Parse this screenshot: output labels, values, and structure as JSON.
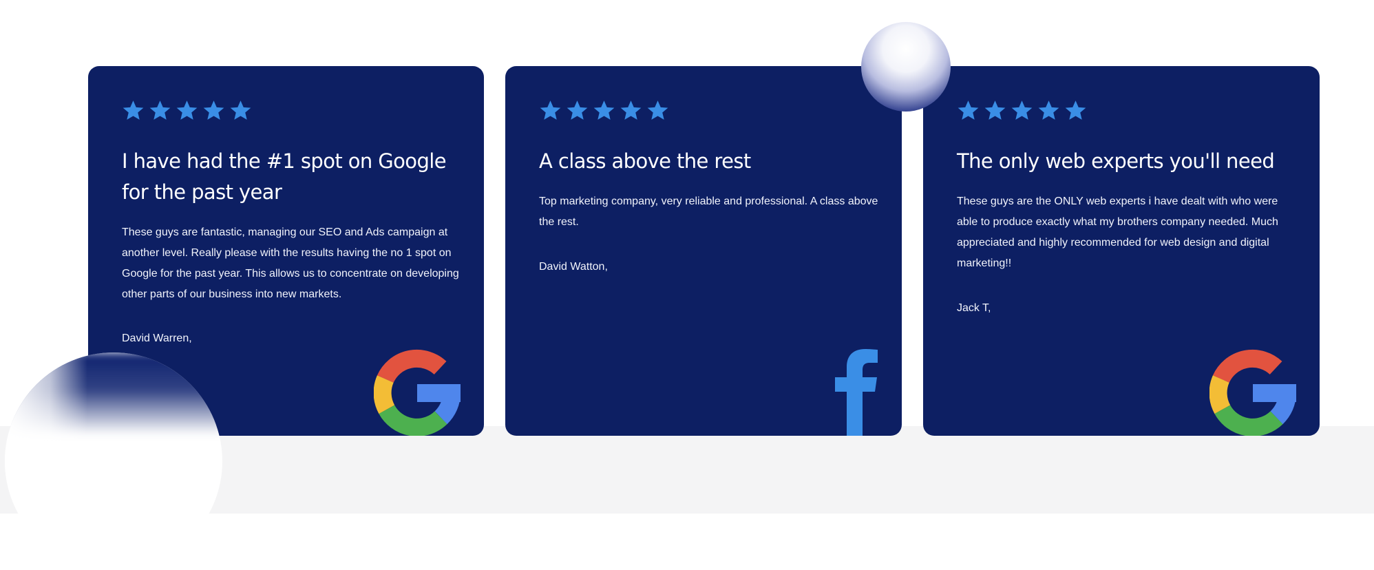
{
  "colors": {
    "card_bg": "#0d1f63",
    "star": "#3a8ee6",
    "facebook": "#3a8ee6",
    "google_red": "#e2533f",
    "google_yellow": "#f3bd36",
    "google_green": "#4db04f",
    "google_blue": "#4f86ec",
    "page_bg": "#ffffff",
    "band_bg": "#f4f4f5"
  },
  "reviews": [
    {
      "rating": 5,
      "title": "I have had the #1 spot on Google for the past year",
      "body": "These guys are fantastic, managing our SEO and Ads campaign at another level. Really please with the results having the no 1 spot on Google for the past year. This allows us to concentrate on developing other parts of our business into new markets.",
      "author": "David Warren,",
      "source_icon": "google-icon"
    },
    {
      "rating": 5,
      "title": "A class above the rest",
      "body": "Top marketing company, very reliable and professional. A class above the rest.",
      "author": "David Watton,",
      "source_icon": "facebook-icon"
    },
    {
      "rating": 5,
      "title": "The only web experts you'll need",
      "body": "These guys are the ONLY web experts i have dealt with who were able to produce exactly what my brothers company needed. Much appreciated and highly recommended for web design and digital marketing!!",
      "author": "Jack T,",
      "source_icon": "google-icon"
    }
  ]
}
